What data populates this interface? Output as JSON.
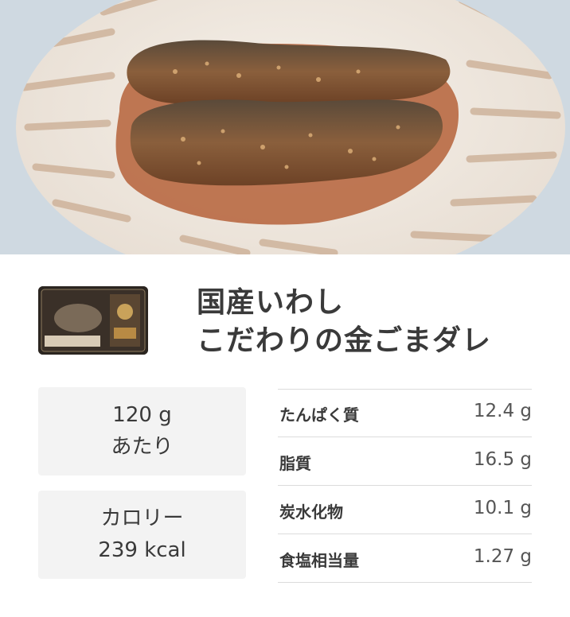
{
  "hero": {
    "image_name": "sardine-in-golden-sesame-sauce-photo"
  },
  "product": {
    "package_image": "product-package-icon",
    "title_line1": "国産いわし",
    "title_line2": "こだわりの金ごまダレ"
  },
  "serving": {
    "amount": "120 g",
    "label": "あたり"
  },
  "calories": {
    "label": "カロリー",
    "value": "239 kcal"
  },
  "nutrition": [
    {
      "label": "たんぱく質",
      "value": "12.4 g"
    },
    {
      "label": "脂質",
      "value": "16.5 g"
    },
    {
      "label": "炭水化物",
      "value": "10.1 g"
    },
    {
      "label": "食塩相当量",
      "value": "1.27 g"
    }
  ],
  "colors": {
    "accent_sauce": "#b5623a",
    "plate_stripe": "#c8a98e",
    "box_bg": "#f3f3f3"
  }
}
